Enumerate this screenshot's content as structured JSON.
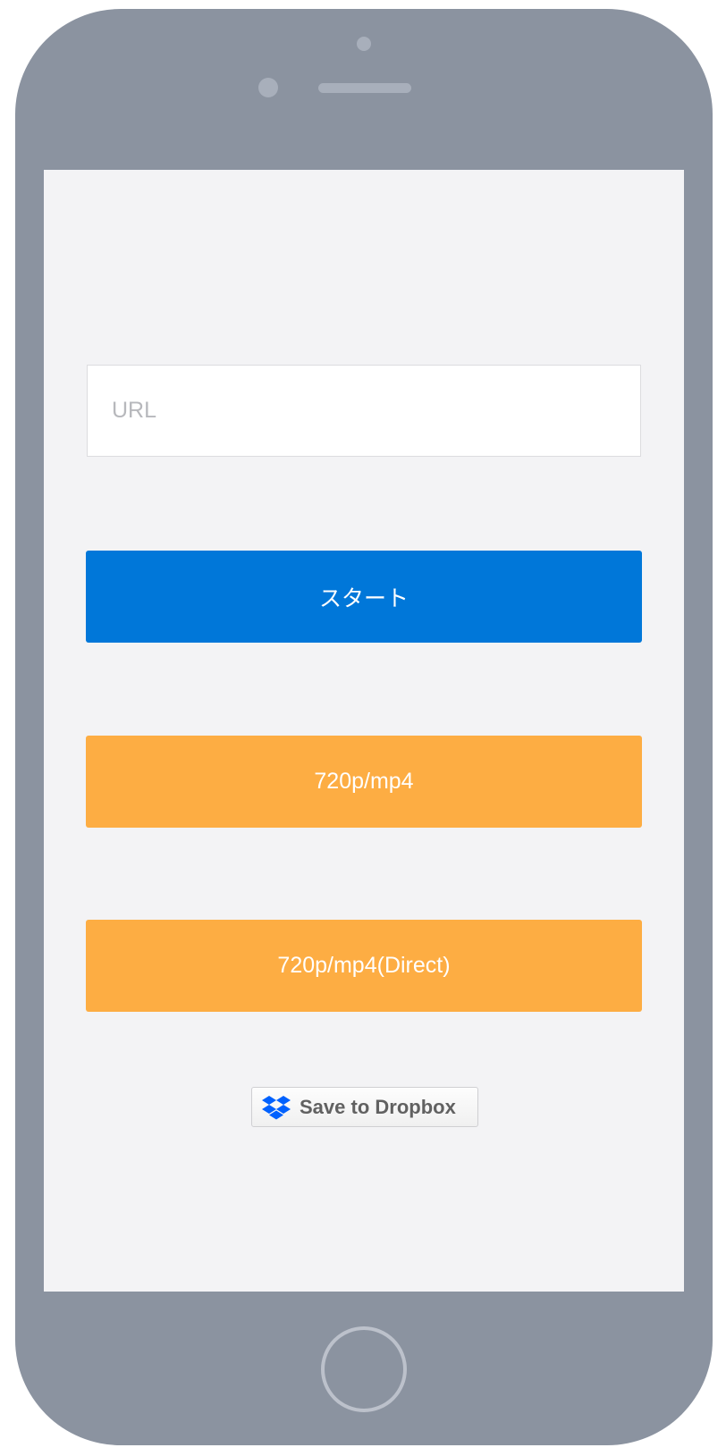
{
  "url_field": {
    "placeholder": "URL",
    "value": ""
  },
  "buttons": {
    "start_label": "スタート",
    "mp4_720_label": "720p/mp4",
    "mp4_720_direct_label": "720p/mp4(Direct)",
    "dropbox_label": "Save to Dropbox"
  },
  "icons": {
    "dropbox": "dropbox-icon"
  },
  "colors": {
    "device_frame": "#8b93a0",
    "screen_background": "#f3f3f5",
    "start_button": "#0077d9",
    "download_button": "#fdad43",
    "dropbox_blue": "#0061fe"
  }
}
